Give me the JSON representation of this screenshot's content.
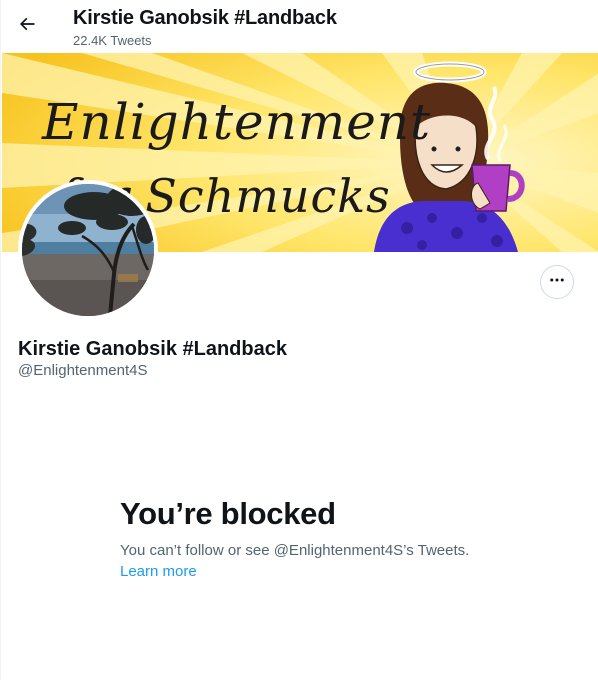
{
  "header": {
    "back_icon": "arrow-left-icon",
    "name": "Kirstie Ganobsik #Landback",
    "tweet_count": "22.4K Tweets"
  },
  "banner": {
    "line1": "Enlightenment",
    "line2": "for Schmucks",
    "colors": {
      "sky": "#ffd84a",
      "rays": "#fff4b0",
      "mug": "#b03fc6",
      "shirt": "#4a2fd0"
    }
  },
  "avatar": {
    "description_icon": "beach-photo"
  },
  "actions": {
    "more_icon": "more-dots-icon"
  },
  "profile": {
    "name": "Kirstie Ganobsik #Landback",
    "handle": "@Enlightenment4S"
  },
  "blocked": {
    "title": "You’re blocked",
    "description": "You can’t follow or see @Enlightenment4S’s Tweets.",
    "link": "Learn more"
  },
  "colors": {
    "link": "#1d9bf0",
    "secondary_text": "#536471",
    "primary_text": "#0f1419"
  }
}
